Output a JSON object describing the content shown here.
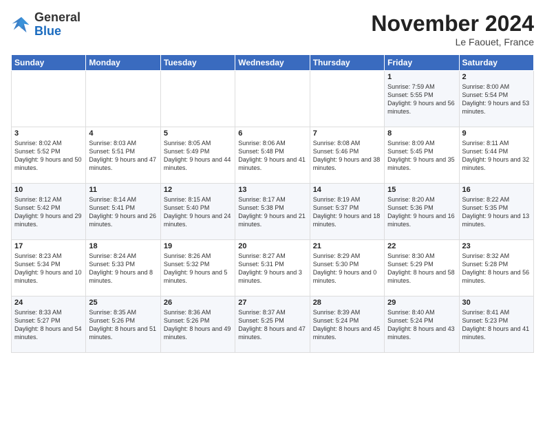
{
  "header": {
    "logo": {
      "general": "General",
      "blue": "Blue"
    },
    "title": "November 2024",
    "location": "Le Faouet, France"
  },
  "weekdays": [
    "Sunday",
    "Monday",
    "Tuesday",
    "Wednesday",
    "Thursday",
    "Friday",
    "Saturday"
  ],
  "weeks": [
    [
      null,
      null,
      null,
      null,
      null,
      {
        "day": "1",
        "sunrise": "Sunrise: 7:59 AM",
        "sunset": "Sunset: 5:55 PM",
        "daylight": "Daylight: 9 hours and 56 minutes."
      },
      {
        "day": "2",
        "sunrise": "Sunrise: 8:00 AM",
        "sunset": "Sunset: 5:54 PM",
        "daylight": "Daylight: 9 hours and 53 minutes."
      }
    ],
    [
      {
        "day": "3",
        "sunrise": "Sunrise: 8:02 AM",
        "sunset": "Sunset: 5:52 PM",
        "daylight": "Daylight: 9 hours and 50 minutes."
      },
      {
        "day": "4",
        "sunrise": "Sunrise: 8:03 AM",
        "sunset": "Sunset: 5:51 PM",
        "daylight": "Daylight: 9 hours and 47 minutes."
      },
      {
        "day": "5",
        "sunrise": "Sunrise: 8:05 AM",
        "sunset": "Sunset: 5:49 PM",
        "daylight": "Daylight: 9 hours and 44 minutes."
      },
      {
        "day": "6",
        "sunrise": "Sunrise: 8:06 AM",
        "sunset": "Sunset: 5:48 PM",
        "daylight": "Daylight: 9 hours and 41 minutes."
      },
      {
        "day": "7",
        "sunrise": "Sunrise: 8:08 AM",
        "sunset": "Sunset: 5:46 PM",
        "daylight": "Daylight: 9 hours and 38 minutes."
      },
      {
        "day": "8",
        "sunrise": "Sunrise: 8:09 AM",
        "sunset": "Sunset: 5:45 PM",
        "daylight": "Daylight: 9 hours and 35 minutes."
      },
      {
        "day": "9",
        "sunrise": "Sunrise: 8:11 AM",
        "sunset": "Sunset: 5:44 PM",
        "daylight": "Daylight: 9 hours and 32 minutes."
      }
    ],
    [
      {
        "day": "10",
        "sunrise": "Sunrise: 8:12 AM",
        "sunset": "Sunset: 5:42 PM",
        "daylight": "Daylight: 9 hours and 29 minutes."
      },
      {
        "day": "11",
        "sunrise": "Sunrise: 8:14 AM",
        "sunset": "Sunset: 5:41 PM",
        "daylight": "Daylight: 9 hours and 26 minutes."
      },
      {
        "day": "12",
        "sunrise": "Sunrise: 8:15 AM",
        "sunset": "Sunset: 5:40 PM",
        "daylight": "Daylight: 9 hours and 24 minutes."
      },
      {
        "day": "13",
        "sunrise": "Sunrise: 8:17 AM",
        "sunset": "Sunset: 5:38 PM",
        "daylight": "Daylight: 9 hours and 21 minutes."
      },
      {
        "day": "14",
        "sunrise": "Sunrise: 8:19 AM",
        "sunset": "Sunset: 5:37 PM",
        "daylight": "Daylight: 9 hours and 18 minutes."
      },
      {
        "day": "15",
        "sunrise": "Sunrise: 8:20 AM",
        "sunset": "Sunset: 5:36 PM",
        "daylight": "Daylight: 9 hours and 16 minutes."
      },
      {
        "day": "16",
        "sunrise": "Sunrise: 8:22 AM",
        "sunset": "Sunset: 5:35 PM",
        "daylight": "Daylight: 9 hours and 13 minutes."
      }
    ],
    [
      {
        "day": "17",
        "sunrise": "Sunrise: 8:23 AM",
        "sunset": "Sunset: 5:34 PM",
        "daylight": "Daylight: 9 hours and 10 minutes."
      },
      {
        "day": "18",
        "sunrise": "Sunrise: 8:24 AM",
        "sunset": "Sunset: 5:33 PM",
        "daylight": "Daylight: 9 hours and 8 minutes."
      },
      {
        "day": "19",
        "sunrise": "Sunrise: 8:26 AM",
        "sunset": "Sunset: 5:32 PM",
        "daylight": "Daylight: 9 hours and 5 minutes."
      },
      {
        "day": "20",
        "sunrise": "Sunrise: 8:27 AM",
        "sunset": "Sunset: 5:31 PM",
        "daylight": "Daylight: 9 hours and 3 minutes."
      },
      {
        "day": "21",
        "sunrise": "Sunrise: 8:29 AM",
        "sunset": "Sunset: 5:30 PM",
        "daylight": "Daylight: 9 hours and 0 minutes."
      },
      {
        "day": "22",
        "sunrise": "Sunrise: 8:30 AM",
        "sunset": "Sunset: 5:29 PM",
        "daylight": "Daylight: 8 hours and 58 minutes."
      },
      {
        "day": "23",
        "sunrise": "Sunrise: 8:32 AM",
        "sunset": "Sunset: 5:28 PM",
        "daylight": "Daylight: 8 hours and 56 minutes."
      }
    ],
    [
      {
        "day": "24",
        "sunrise": "Sunrise: 8:33 AM",
        "sunset": "Sunset: 5:27 PM",
        "daylight": "Daylight: 8 hours and 54 minutes."
      },
      {
        "day": "25",
        "sunrise": "Sunrise: 8:35 AM",
        "sunset": "Sunset: 5:26 PM",
        "daylight": "Daylight: 8 hours and 51 minutes."
      },
      {
        "day": "26",
        "sunrise": "Sunrise: 8:36 AM",
        "sunset": "Sunset: 5:26 PM",
        "daylight": "Daylight: 8 hours and 49 minutes."
      },
      {
        "day": "27",
        "sunrise": "Sunrise: 8:37 AM",
        "sunset": "Sunset: 5:25 PM",
        "daylight": "Daylight: 8 hours and 47 minutes."
      },
      {
        "day": "28",
        "sunrise": "Sunrise: 8:39 AM",
        "sunset": "Sunset: 5:24 PM",
        "daylight": "Daylight: 8 hours and 45 minutes."
      },
      {
        "day": "29",
        "sunrise": "Sunrise: 8:40 AM",
        "sunset": "Sunset: 5:24 PM",
        "daylight": "Daylight: 8 hours and 43 minutes."
      },
      {
        "day": "30",
        "sunrise": "Sunrise: 8:41 AM",
        "sunset": "Sunset: 5:23 PM",
        "daylight": "Daylight: 8 hours and 41 minutes."
      }
    ]
  ]
}
